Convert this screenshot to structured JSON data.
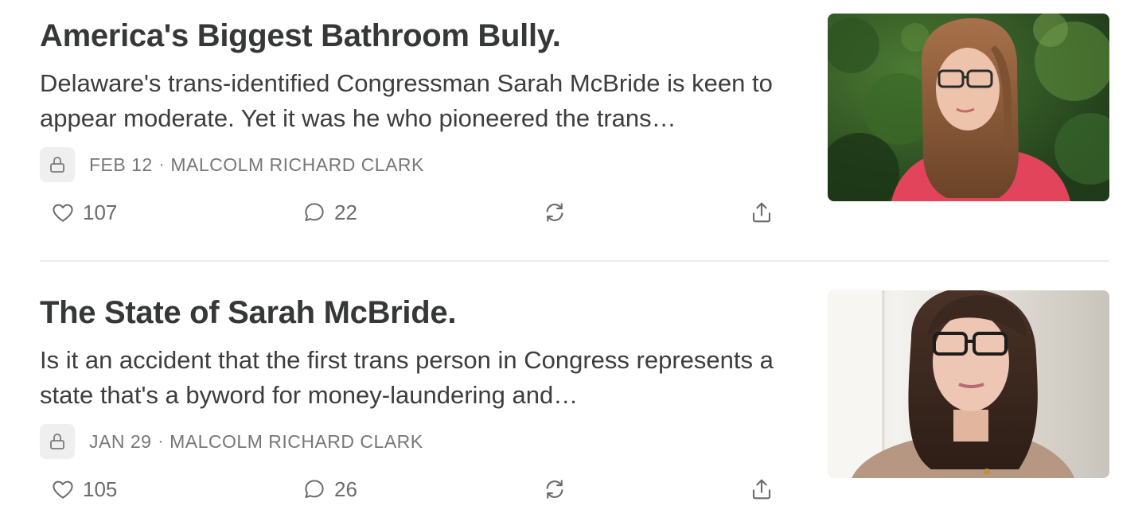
{
  "posts": [
    {
      "title": "America's Biggest Bathroom Bully.",
      "subtitle": "Delaware's trans-identified Congressman Sarah McBride is keen to appear moderate. Yet it was he who pioneered the trans…",
      "date": "FEB 12",
      "author": "MALCOLM RICHARD CLARK",
      "likes": "107",
      "comments": "22",
      "thumbnail": "woman-glasses-pink-top-outdoors-photo"
    },
    {
      "title": "The State of Sarah McBride.",
      "subtitle": "Is it an accident that the first trans person in Congress represents a state that's a byword for money-laundering and…",
      "date": "JAN 29",
      "author": "MALCOLM RICHARD CLARK",
      "likes": "105",
      "comments": "26",
      "thumbnail": "woman-glasses-portrait-photo"
    }
  ],
  "meta_separator": "·",
  "icons": {
    "lock": "lock-icon",
    "like": "heart-icon",
    "comment": "comment-icon",
    "restack": "restack-icon",
    "share": "share-icon"
  },
  "colors": {
    "title": "#363737",
    "meta": "#777777",
    "icon": "#6b6b6b",
    "badge_bg": "#efefef",
    "divider": "#ececec"
  }
}
